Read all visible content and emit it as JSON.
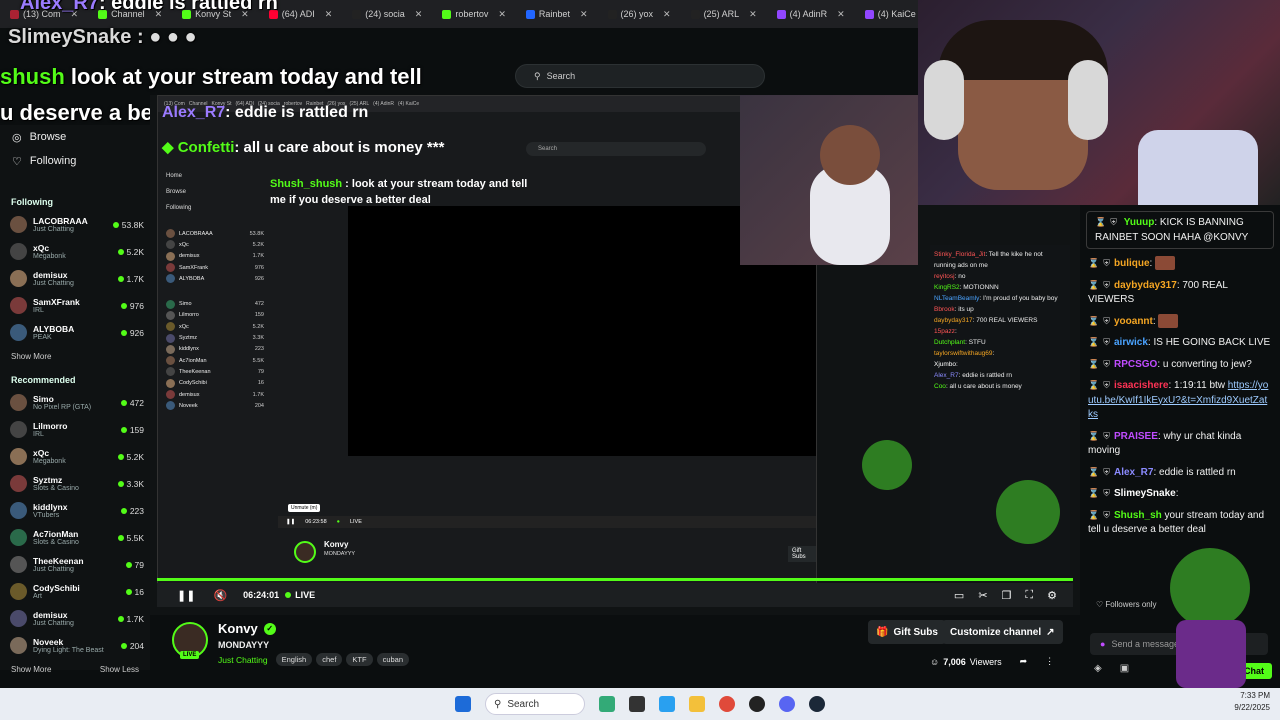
{
  "browser": {
    "tabs": [
      {
        "label": "(13) Com",
        "color": "#aa2233"
      },
      {
        "label": "Channel",
        "color": "#53fc18"
      },
      {
        "label": "Konvy St",
        "color": "#53fc18"
      },
      {
        "label": "(64) ADI",
        "color": "#ff0033"
      },
      {
        "label": "(24) socia",
        "color": "#222222"
      },
      {
        "label": "robertov",
        "color": "#53fc18"
      },
      {
        "label": "Rainbet",
        "color": "#2266ff"
      },
      {
        "label": "(26) yox",
        "color": "#222222"
      },
      {
        "label": "(25) ARL",
        "color": "#222222"
      },
      {
        "label": "(4) AdinR",
        "color": "#9146ff"
      },
      {
        "label": "(4) KaiCe",
        "color": "#9146ff"
      }
    ]
  },
  "overlay": {
    "line1_user": "Alex_R7",
    "line1_text": ": eddie is rattled rn",
    "line2_user": "SlimeySnake",
    "line2_text": ":",
    "line3_user": "shush",
    "line3_text": " look at your stream today and tell",
    "line4_text": "u deserve a better deal",
    "line5_user": "Alex_R7",
    "line5_text": ": eddie is rattled rn",
    "line6_user": "Confetti",
    "line6_text": ": all u care about is money ***"
  },
  "search": {
    "placeholder": "Search"
  },
  "sidebar": {
    "nav": [
      {
        "label": "Browse",
        "icon": "compass-icon"
      },
      {
        "label": "Following",
        "icon": "heart-icon"
      }
    ],
    "following_title": "Following",
    "following": [
      {
        "name": "LACOBRAAA",
        "category": "Just Chatting",
        "viewers": "53.8K"
      },
      {
        "name": "xQc",
        "category": "Megabonk",
        "viewers": "5.2K"
      },
      {
        "name": "demisux",
        "category": "Just Chatting",
        "viewers": "1.7K"
      },
      {
        "name": "SamXFrank",
        "category": "IRL",
        "viewers": "976"
      },
      {
        "name": "ALYBOBA",
        "category": "PEAK",
        "viewers": "926"
      }
    ],
    "show_more": "Show More",
    "recommended_title": "Recommended",
    "recommended": [
      {
        "name": "Simo",
        "category": "No Pixel RP (GTA)",
        "viewers": "472"
      },
      {
        "name": "Lilmorro",
        "category": "IRL",
        "viewers": "159"
      },
      {
        "name": "xQc",
        "category": "Megabonk",
        "viewers": "5.2K"
      },
      {
        "name": "Syztmz",
        "category": "Slots & Casino",
        "viewers": "3.3K"
      },
      {
        "name": "kiddlynx",
        "category": "VTubers",
        "viewers": "223"
      },
      {
        "name": "Ac7ionMan",
        "category": "Slots & Casino",
        "viewers": "5.5K"
      },
      {
        "name": "TheeKeenan",
        "category": "Just Chatting",
        "viewers": "79"
      },
      {
        "name": "CodySchibi",
        "category": "Art",
        "viewers": "16"
      },
      {
        "name": "demisux",
        "category": "Just Chatting",
        "viewers": "1.7K"
      },
      {
        "name": "Noveek",
        "category": "Dying Light: The Beast",
        "viewers": "204"
      }
    ],
    "show_more2": "Show More",
    "show_less": "Show Less"
  },
  "nested": {
    "home": "Home",
    "browse": "Browse",
    "following": "Following",
    "search": "Search",
    "unmute": "Unmute (m)",
    "time": "06:23:58",
    "live": "LIVE"
  },
  "player": {
    "time": "06:24:01",
    "live": "LIVE"
  },
  "stream": {
    "name": "Konvy",
    "title": "MONDAYYY",
    "category": "Just Chatting",
    "tags": [
      "English",
      "chef",
      "KTF",
      "cuban"
    ],
    "live_badge": "LIVE",
    "viewers": "7,006",
    "viewers_label": "Viewers",
    "gift_subs": "Gift Subs",
    "customize": "Customize channel"
  },
  "chat": {
    "pinned": {
      "user": "Yuuup",
      "text": ": KICK IS BANNING RAINBET SOON HAHA @KONVY"
    },
    "messages": [
      {
        "user": "bulique",
        "color": "#f5a623",
        "text": ":"
      },
      {
        "user": "daybyday317",
        "color": "#f5a623",
        "text": ": 700 REAL VIEWERS"
      },
      {
        "user": "yooannt",
        "color": "#f5a623",
        "text": ":"
      },
      {
        "user": "airwick",
        "color": "#4aa3ff",
        "text": ": IS HE GOING BACK LIVE"
      },
      {
        "user": "RPCSGO",
        "color": "#c04cff",
        "text": ": u converting to jew?"
      },
      {
        "user": "isaacishere",
        "color": "#ff3355",
        "text": ": 1:19:11 btw"
      },
      {
        "user": "PRAISEE",
        "color": "#c04cff",
        "text": ": why ur chat kinda moving"
      },
      {
        "user": "Alex_R7",
        "color": "#8b8bff",
        "text": ": eddie is rattled rn"
      },
      {
        "user": "SlimeySnake",
        "color": "#ffffff",
        "text": ":"
      },
      {
        "user": "Shush_sh",
        "color": "#53fc18",
        "text": " your stream today and tell u deserve a better deal"
      }
    ],
    "link": "https://youtu.be/KwIf1IkEyxU?&t=Xmfizd9XuetZatks",
    "followers_only": "Followers only",
    "send_placeholder": "Send a message",
    "chat_button": "Chat"
  },
  "taskbar": {
    "search": "Search",
    "time": "7:33 PM",
    "date": "9/22/2025"
  }
}
